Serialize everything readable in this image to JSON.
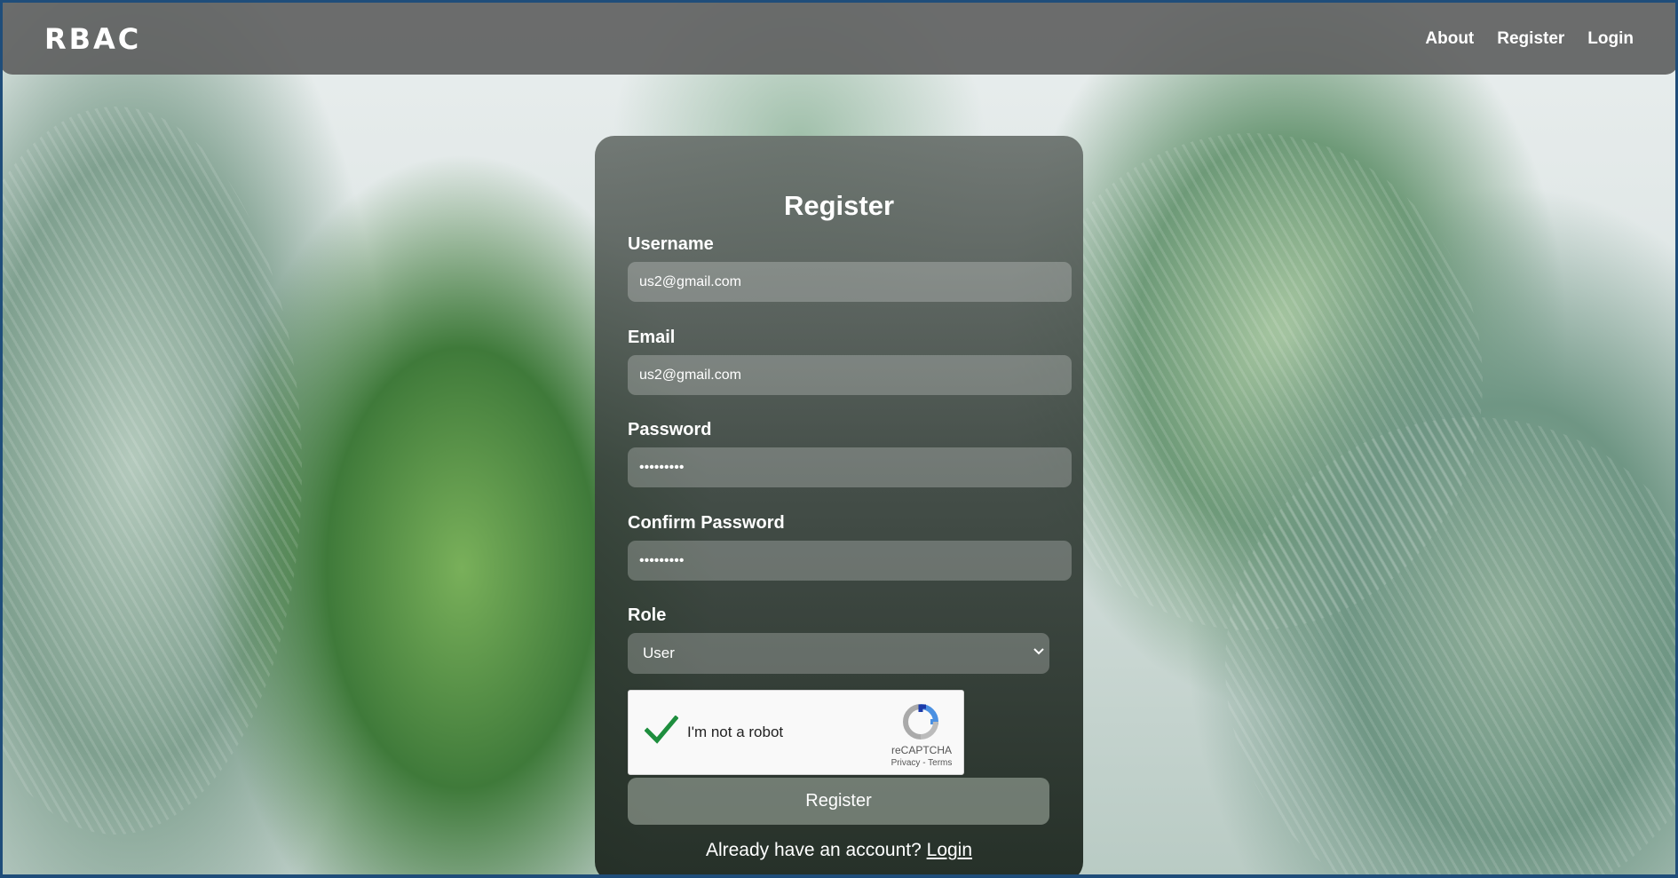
{
  "nav": {
    "brand": "RBAC",
    "links": [
      "About",
      "Register",
      "Login"
    ]
  },
  "form": {
    "title": "Register",
    "fields": [
      {
        "label": "Username",
        "value": "us2@gmail.com"
      },
      {
        "label": "Email",
        "value": "us2@gmail.com"
      },
      {
        "label": "Password",
        "value": "•••••••••"
      },
      {
        "label": "Confirm Password",
        "value": "•••••••••"
      }
    ],
    "role": {
      "label": "Role",
      "selected": "User"
    },
    "captcha": {
      "label": "I'm not a robot",
      "brand": "reCAPTCHA",
      "links": "Privacy - Terms",
      "checked": true
    },
    "submit_label": "Register",
    "footer_text": "Already have an account?",
    "footer_link": "Login"
  },
  "colors": {
    "nav_bg": "#5f6161",
    "card_top": "#696f6c",
    "card_bottom": "#1e2820",
    "check_green": "#1e8e3e",
    "frame": "#1f4d7a"
  }
}
